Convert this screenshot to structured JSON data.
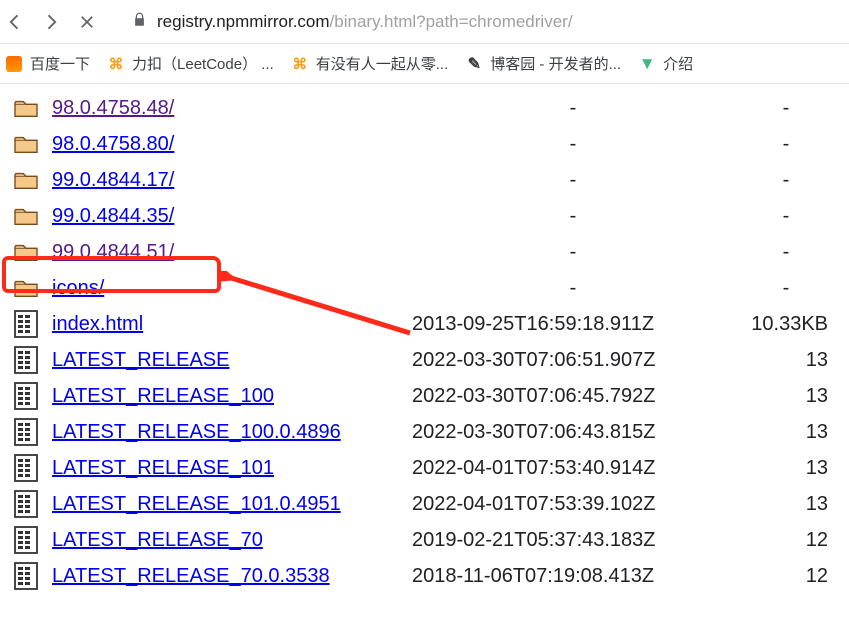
{
  "toolbar": {
    "url_host": "registry.npmmirror.com",
    "url_path": "/binary.html?path=chromedriver/"
  },
  "bookmarks": [
    {
      "label": "百度一下",
      "icon": "baidu"
    },
    {
      "label": "力扣（LeetCode） ...",
      "icon": "leet"
    },
    {
      "label": "有没有人一起从零...",
      "icon": "leet2"
    },
    {
      "label": "博客园 - 开发者的...",
      "icon": "blog"
    },
    {
      "label": "介绍",
      "icon": "vue"
    }
  ],
  "rows": [
    {
      "type": "folder",
      "name": "98.0.4758.48/",
      "date": "-",
      "size": "-",
      "visited": true
    },
    {
      "type": "folder",
      "name": "98.0.4758.80/",
      "date": "-",
      "size": "-",
      "visited": false
    },
    {
      "type": "folder",
      "name": "99.0.4844.17/",
      "date": "-",
      "size": "-",
      "visited": false
    },
    {
      "type": "folder",
      "name": "99.0.4844.35/",
      "date": "-",
      "size": "-",
      "visited": false
    },
    {
      "type": "folder",
      "name": "99.0.4844.51/",
      "date": "-",
      "size": "-",
      "visited": true
    },
    {
      "type": "folder",
      "name": "icons/",
      "date": "-",
      "size": "-",
      "visited": false
    },
    {
      "type": "file",
      "name": "index.html",
      "date": "2013-09-25T16:59:18.911Z",
      "size": "10.33KB",
      "visited": false
    },
    {
      "type": "file",
      "name": "LATEST_RELEASE",
      "date": "2022-03-30T07:06:51.907Z",
      "size": "13",
      "visited": false
    },
    {
      "type": "file",
      "name": "LATEST_RELEASE_100",
      "date": "2022-03-30T07:06:45.792Z",
      "size": "13",
      "visited": false
    },
    {
      "type": "file",
      "name": "LATEST_RELEASE_100.0.4896",
      "date": "2022-03-30T07:06:43.815Z",
      "size": "13",
      "visited": false
    },
    {
      "type": "file",
      "name": "LATEST_RELEASE_101",
      "date": "2022-04-01T07:53:40.914Z",
      "size": "13",
      "visited": false
    },
    {
      "type": "file",
      "name": "LATEST_RELEASE_101.0.4951",
      "date": "2022-04-01T07:53:39.102Z",
      "size": "13",
      "visited": false
    },
    {
      "type": "file",
      "name": "LATEST_RELEASE_70",
      "date": "2019-02-21T05:37:43.183Z",
      "size": "12",
      "visited": false
    },
    {
      "type": "file",
      "name": "LATEST_RELEASE_70.0.3538",
      "date": "2018-11-06T07:19:08.413Z",
      "size": "12",
      "visited": false
    }
  ],
  "dash": "-"
}
